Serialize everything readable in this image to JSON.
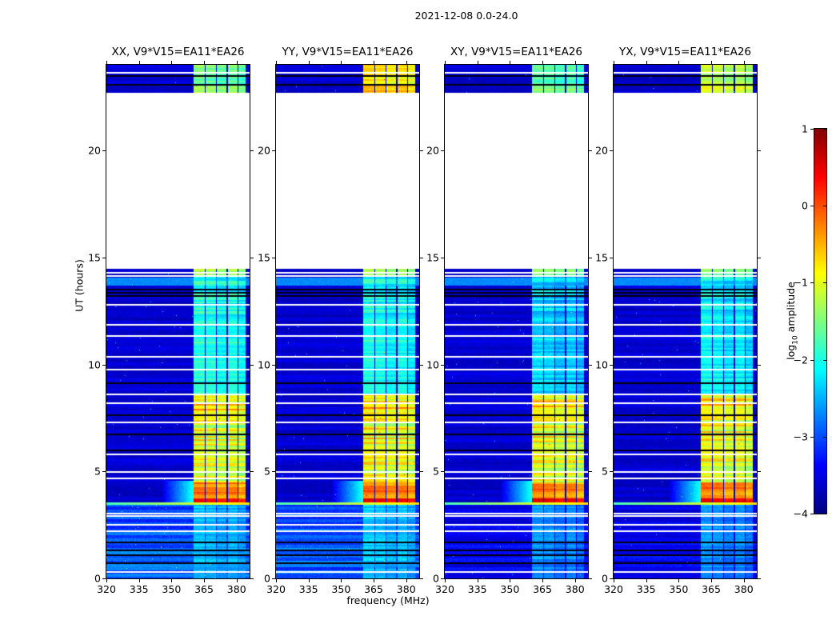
{
  "figure": {
    "title": "2021-12-08 0.0-24.0",
    "background": "#ffffff"
  },
  "chart_data": {
    "type": "heatmap",
    "title": "2021-12-08 0.0-24.0",
    "xlabel": "frequency (MHz)",
    "ylabel": "UT (hours)",
    "x_range": [
      320,
      386
    ],
    "y_range": [
      0,
      24
    ],
    "x_ticks": [
      320,
      335,
      350,
      365,
      380
    ],
    "y_ticks": [
      0,
      5,
      10,
      15,
      20
    ],
    "colorbar": {
      "label_pre": "log",
      "label_sub": "10",
      "label_post": " amplitude",
      "range": [
        -4,
        1
      ],
      "ticks": [
        1,
        0,
        -1,
        -2,
        -3,
        -4
      ],
      "colormap": "jet"
    },
    "time_coverage_hours": [
      [
        0,
        14.47
      ],
      [
        22.7,
        24.0
      ]
    ],
    "rfi_band_mhz": [
      360.3,
      384.2
    ],
    "band_divider_mhz": [
      365.3,
      370.4,
      375.4,
      380.4
    ],
    "band_divider_width_mhz": 0.55,
    "band_column_offsets": [
      0.05,
      0.0,
      -0.12,
      -0.02,
      -0.18
    ],
    "white_line_hours": [
      23.66,
      14.32,
      14.17,
      12.82,
      11.9,
      11.36,
      10.4,
      9.8,
      8.62,
      8.22,
      7.32,
      5.82,
      5.02,
      4.72,
      3.06,
      2.94,
      2.56,
      2.24,
      0.32
    ],
    "black_line_hours": [
      23.53,
      23.12,
      13.52,
      13.38,
      13.23,
      9.17,
      7.67,
      6.77,
      6.02,
      1.72,
      1.36,
      1.12,
      0.76
    ],
    "cyan_row_hours": [
      [
        13.7,
        14.05
      ]
    ],
    "cyan_row_value": -2.7,
    "yellow_line_hours": [
      3.44,
      3.57
    ],
    "yellow_line_values": [
      -1.8,
      -0.7
    ],
    "wedge": {
      "hours": [
        3.57,
        4.55
      ],
      "mhz": [
        346,
        360.3
      ],
      "values": [
        -3.5,
        -2.0
      ]
    },
    "panels": [
      {
        "label": "XX, V9*V15=EA11*EA26",
        "pol": "XX",
        "background_segments": [
          {
            "h": [
              3.57,
              24.0
            ],
            "v": -3.6,
            "s": 0.12
          },
          {
            "h": [
              0.0,
              3.44
            ],
            "v": -2.95,
            "s": 0.3
          }
        ],
        "band_segments": [
          {
            "h": [
              23.12,
              24.0
            ],
            "v": -1.6,
            "s": 0.25
          },
          {
            "h": [
              22.7,
              23.12
            ],
            "v": -1.35,
            "s": 0.25
          },
          {
            "h": [
              14.1,
              14.47
            ],
            "v": -1.35,
            "s": 0.3
          },
          {
            "h": [
              8.6,
              14.1
            ],
            "v": -2.0,
            "s": 0.3
          },
          {
            "h": [
              7.3,
              8.6
            ],
            "v": -0.75,
            "s": 0.55
          },
          {
            "h": [
              4.5,
              7.3
            ],
            "v": -1.0,
            "s": 0.5
          },
          {
            "h": [
              3.75,
              4.5
            ],
            "v": -0.25,
            "s": 0.35
          },
          {
            "h": [
              3.57,
              3.75
            ],
            "v": 0.45,
            "s": 0.2
          },
          {
            "h": [
              0.0,
              3.44
            ],
            "v": -2.5,
            "s": 0.2
          }
        ]
      },
      {
        "label": "YY, V9*V15=EA11*EA26",
        "pol": "YY",
        "background_segments": [
          {
            "h": [
              3.57,
              24.0
            ],
            "v": -3.6,
            "s": 0.12
          },
          {
            "h": [
              0.0,
              3.44
            ],
            "v": -2.95,
            "s": 0.3
          }
        ],
        "band_segments": [
          {
            "h": [
              23.12,
              24.0
            ],
            "v": -0.75,
            "s": 0.25
          },
          {
            "h": [
              22.7,
              23.12
            ],
            "v": -0.55,
            "s": 0.25
          },
          {
            "h": [
              14.1,
              14.47
            ],
            "v": -1.3,
            "s": 0.3
          },
          {
            "h": [
              8.6,
              14.1
            ],
            "v": -2.05,
            "s": 0.3
          },
          {
            "h": [
              7.3,
              8.6
            ],
            "v": -0.7,
            "s": 0.55
          },
          {
            "h": [
              4.5,
              7.3
            ],
            "v": -0.9,
            "s": 0.5
          },
          {
            "h": [
              3.75,
              4.5
            ],
            "v": -0.2,
            "s": 0.35
          },
          {
            "h": [
              3.57,
              3.75
            ],
            "v": 0.5,
            "s": 0.2
          },
          {
            "h": [
              0.0,
              3.44
            ],
            "v": -2.45,
            "s": 0.2
          }
        ]
      },
      {
        "label": "XY, V9*V15=EA11*EA26",
        "pol": "XY",
        "background_segments": [
          {
            "h": [
              3.57,
              24.0
            ],
            "v": -3.6,
            "s": 0.12
          },
          {
            "h": [
              0.0,
              3.44
            ],
            "v": -3.45,
            "s": 0.2
          }
        ],
        "band_segments": [
          {
            "h": [
              23.12,
              24.0
            ],
            "v": -1.7,
            "s": 0.25
          },
          {
            "h": [
              22.7,
              23.12
            ],
            "v": -1.5,
            "s": 0.25
          },
          {
            "h": [
              14.1,
              14.47
            ],
            "v": -1.4,
            "s": 0.3
          },
          {
            "h": [
              8.6,
              14.1
            ],
            "v": -2.35,
            "s": 0.3
          },
          {
            "h": [
              7.3,
              8.6
            ],
            "v": -0.8,
            "s": 0.55
          },
          {
            "h": [
              4.5,
              7.3
            ],
            "v": -0.95,
            "s": 0.5
          },
          {
            "h": [
              3.75,
              4.5
            ],
            "v": -0.25,
            "s": 0.35
          },
          {
            "h": [
              3.57,
              3.75
            ],
            "v": 0.55,
            "s": 0.2
          },
          {
            "h": [
              0.0,
              3.44
            ],
            "v": -2.7,
            "s": 0.2
          }
        ]
      },
      {
        "label": "YX, V9*V15=EA11*EA26",
        "pol": "YX",
        "background_segments": [
          {
            "h": [
              3.57,
              24.0
            ],
            "v": -3.6,
            "s": 0.12
          },
          {
            "h": [
              0.0,
              3.44
            ],
            "v": -3.45,
            "s": 0.2
          }
        ],
        "band_segments": [
          {
            "h": [
              23.12,
              24.0
            ],
            "v": -1.2,
            "s": 0.25
          },
          {
            "h": [
              22.7,
              23.12
            ],
            "v": -1.0,
            "s": 0.25
          },
          {
            "h": [
              14.1,
              14.47
            ],
            "v": -1.4,
            "s": 0.3
          },
          {
            "h": [
              8.6,
              14.1
            ],
            "v": -2.15,
            "s": 0.3
          },
          {
            "h": [
              7.3,
              8.6
            ],
            "v": -0.8,
            "s": 0.55
          },
          {
            "h": [
              4.5,
              7.3
            ],
            "v": -0.9,
            "s": 0.5
          },
          {
            "h": [
              3.75,
              4.5
            ],
            "v": -0.25,
            "s": 0.35
          },
          {
            "h": [
              3.57,
              3.75
            ],
            "v": 0.5,
            "s": 0.2
          },
          {
            "h": [
              0.0,
              3.44
            ],
            "v": -2.7,
            "s": 0.2
          }
        ]
      }
    ]
  }
}
